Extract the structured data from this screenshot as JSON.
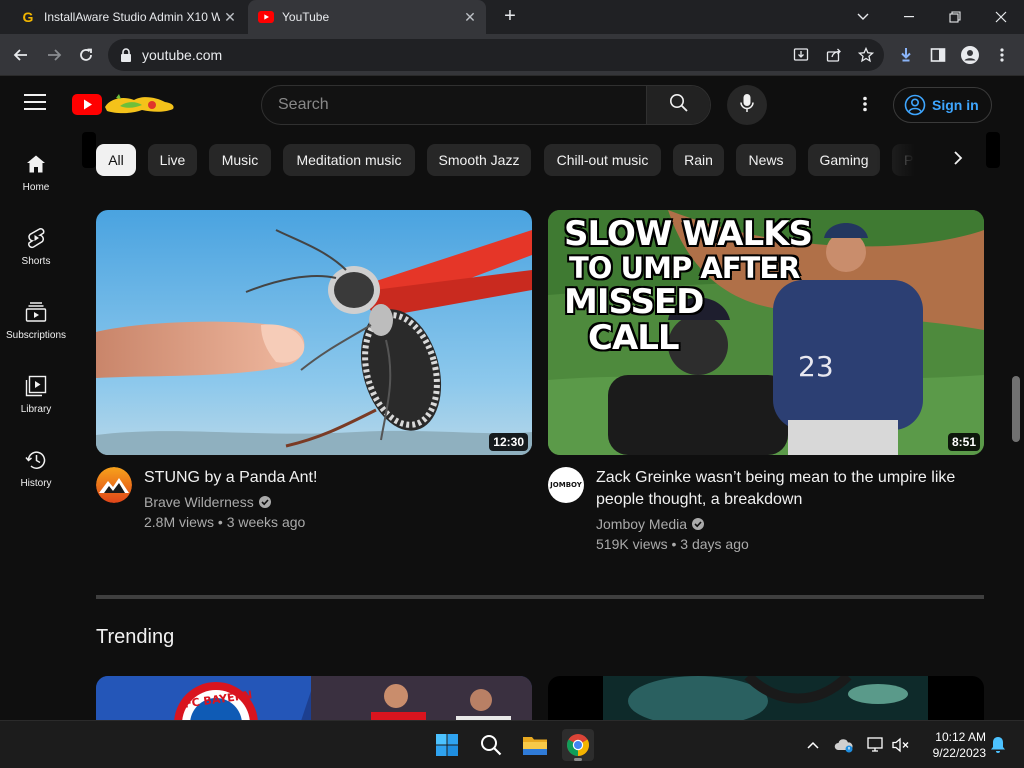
{
  "browser": {
    "tabs": [
      {
        "title": "InstallAware Studio Admin X10 W",
        "favicon": "installaware-g-icon"
      },
      {
        "title": "YouTube",
        "favicon": "youtube-icon"
      }
    ],
    "url": "youtube.com"
  },
  "youtube": {
    "search_placeholder": "Search",
    "sign_in_label": "Sign in",
    "sidebar": [
      {
        "label": "Home",
        "icon": "home-icon"
      },
      {
        "label": "Shorts",
        "icon": "shorts-icon"
      },
      {
        "label": "Subscriptions",
        "icon": "subscriptions-icon"
      },
      {
        "label": "Library",
        "icon": "library-icon"
      },
      {
        "label": "History",
        "icon": "history-icon"
      }
    ],
    "chips": [
      "All",
      "Live",
      "Music",
      "Meditation music",
      "Smooth Jazz",
      "Chill-out music",
      "Rain",
      "News",
      "Gaming",
      "P"
    ],
    "videos": [
      {
        "title": "STUNG by a Panda Ant!",
        "channel": "Brave Wilderness",
        "stats": "2.8M views • 3 weeks ago",
        "duration": "12:30"
      },
      {
        "title": "Zack Greinke wasn’t being mean to the umpire like people thought, a breakdown",
        "channel": "Jomboy Media",
        "stats": "519K views • 3 days ago",
        "duration": "8:51",
        "thumb_text": [
          "SLOW WALKS",
          "TO UMP AFTER",
          "MISSED",
          "CALL"
        ],
        "jersey_number": "23",
        "channel_avatar_text": "JOMBOY"
      }
    ],
    "section_title": "Trending",
    "trending_thumb_text": "FC BAYERN"
  },
  "taskbar": {
    "time": "10:12 AM",
    "date": "9/22/2023",
    "pinned": [
      "windows-start-icon",
      "search-icon",
      "file-explorer-icon",
      "chrome-icon"
    ]
  },
  "colors": {
    "background": "#0f0f0f",
    "accent_blue": "#3ea6ff",
    "youtube_red": "#ff0000"
  }
}
